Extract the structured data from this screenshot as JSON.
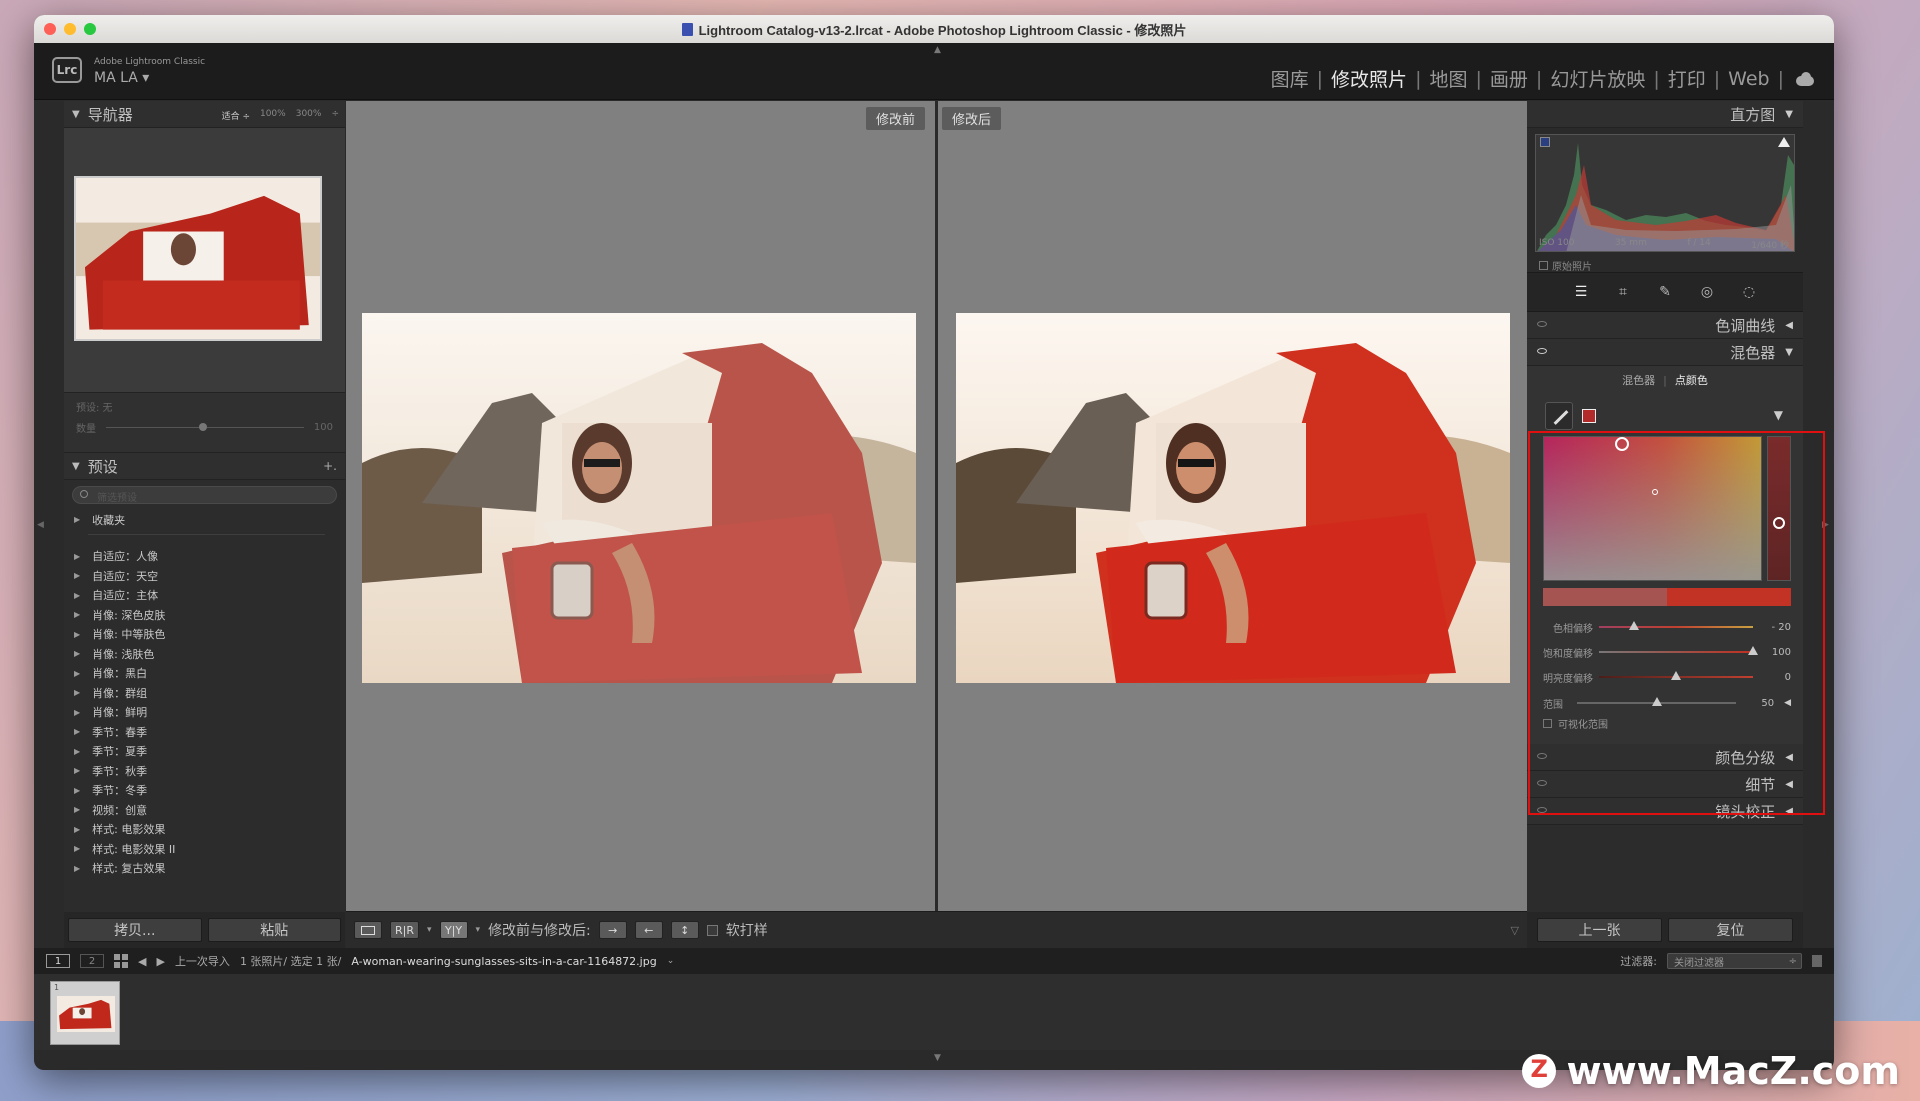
{
  "window": {
    "title": "Lightroom Catalog-v13-2.lrcat - Adobe Photoshop Lightroom Classic - 修改照片"
  },
  "brand": {
    "logo": "Lrc",
    "product": "Adobe Lightroom Classic",
    "user": "MA LA"
  },
  "modules": [
    {
      "label": "图库",
      "active": false
    },
    {
      "label": "修改照片",
      "active": true
    },
    {
      "label": "地图",
      "active": false
    },
    {
      "label": "画册",
      "active": false
    },
    {
      "label": "幻灯片放映",
      "active": false
    },
    {
      "label": "打印",
      "active": false
    },
    {
      "label": "Web",
      "active": false
    }
  ],
  "navigator": {
    "title": "导航器",
    "zoom": [
      "适合 ÷",
      "100%",
      "300%",
      "÷"
    ]
  },
  "preset_amount": {
    "label": "预设: 无",
    "amount_label": "数量",
    "amount_value": "100",
    "amount_level": 0.47
  },
  "presets": {
    "title": "预设",
    "add": "+.",
    "search_placeholder": "筛选预设",
    "favorites": "收藏夹",
    "items": [
      "自适应：人像",
      "自适应：天空",
      "自适应：主体",
      "肖像: 深色皮肤",
      "肖像: 中等肤色",
      "肖像: 浅肤色",
      "肖像：黑白",
      "肖像：群组",
      "肖像：鲜明",
      "季节：春季",
      "季节：夏季",
      "季节：秋季",
      "季节：冬季",
      "视频：创意",
      "样式: 电影效果",
      "样式: 电影效果 II",
      "样式: 复古效果"
    ]
  },
  "left_buttons": {
    "copy": "拷贝...",
    "paste": "粘贴"
  },
  "compare": {
    "before": "修改前",
    "after": "修改后"
  },
  "toolbar": {
    "view_rr": "R|R",
    "view_yy": "Y|Y",
    "before_after_label": "修改前与修改后:",
    "soft_proof": "软打样"
  },
  "right_panel": {
    "histogram_title": "直方图",
    "iso": "ISO 100",
    "focal": "35 mm",
    "aperture": "f / 14",
    "shutter": "1/640 秒",
    "original_photo": "原始照片",
    "tone_curve": "色调曲线",
    "color_mixer": "混色器",
    "tab_mixer": "混色器",
    "tab_point_color": "点颜色",
    "sliders": [
      {
        "label": "色相偏移",
        "value": "- 20",
        "level": 0.23
      },
      {
        "label": "饱和度偏移",
        "value": "100",
        "level": 1.0
      },
      {
        "label": "明亮度偏移",
        "value": "0",
        "level": 0.5
      }
    ],
    "range": {
      "label": "范围",
      "value": "50",
      "level": 0.5
    },
    "visualize_range": "可视化范围",
    "color_grading": "颜色分级",
    "detail": "细节",
    "lens_correction": "镜头校正",
    "prev": "上一张",
    "reset": "复位",
    "accent_color": "#e01010"
  },
  "filmstrip": {
    "page1": "1",
    "page2": "2",
    "path": "上一次导入",
    "info": "1 张照片/ 选定 1 张/",
    "filename": "A-woman-wearing-sunglasses-sits-in-a-car-1164872.jpg",
    "filter_label": "过滤器:",
    "filter_value": "关闭过滤器",
    "thumb_index": "1"
  },
  "watermark": "www.MacZ.com"
}
